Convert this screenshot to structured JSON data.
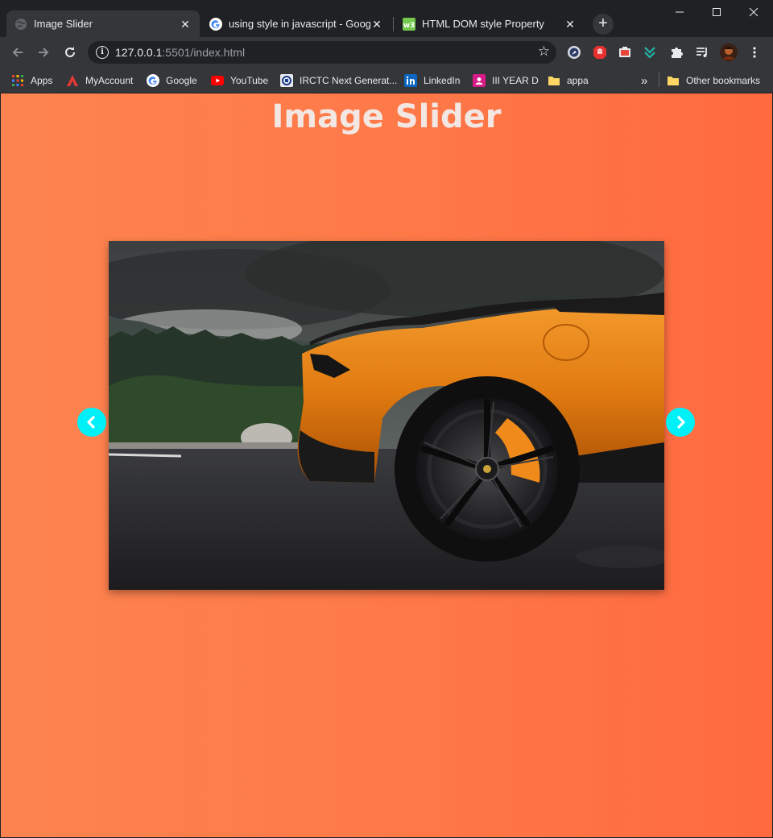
{
  "tabs": [
    {
      "title": "Image Slider",
      "active": true,
      "icon": "globe-icon"
    },
    {
      "title": "using style in javascript - Google",
      "active": false,
      "icon": "google-icon"
    },
    {
      "title": "HTML DOM style Property",
      "active": false,
      "icon": "w3schools-icon"
    }
  ],
  "address_bar": {
    "host": "127.0.0.1",
    "path": ":5501/index.html"
  },
  "bookmarks": [
    {
      "label": "Apps",
      "icon": "apps-grid-icon"
    },
    {
      "label": "MyAccount",
      "icon": "myaccount-icon"
    },
    {
      "label": "Google",
      "icon": "google-icon"
    },
    {
      "label": "YouTube",
      "icon": "youtube-icon"
    },
    {
      "label": "IRCTC Next Generat...",
      "icon": "irctc-icon"
    },
    {
      "label": "LinkedIn",
      "icon": "linkedin-icon"
    },
    {
      "label": "III YEAR D",
      "icon": "classroom-icon"
    },
    {
      "label": "appa",
      "icon": "folder-icon"
    }
  ],
  "bookmarks_overflow": "»",
  "other_bookmarks": "Other bookmarks",
  "page": {
    "heading": "Image Slider"
  },
  "colors": {
    "page_gradient_start": "#fd8450",
    "page_gradient_end": "#ff6a40",
    "arrow": "#00f0f8",
    "heading": "#f3e7e4"
  }
}
